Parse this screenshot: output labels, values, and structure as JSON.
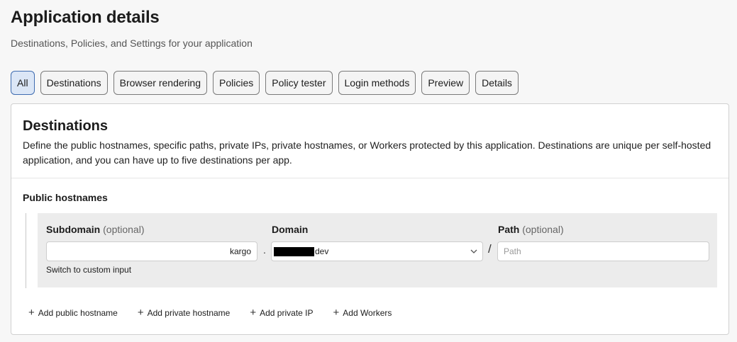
{
  "page": {
    "title": "Application details",
    "subtitle": "Destinations, Policies, and Settings for your application"
  },
  "tabs": [
    {
      "label": "All",
      "active": true
    },
    {
      "label": "Destinations",
      "active": false
    },
    {
      "label": "Browser rendering",
      "active": false
    },
    {
      "label": "Policies",
      "active": false
    },
    {
      "label": "Policy tester",
      "active": false
    },
    {
      "label": "Login methods",
      "active": false
    },
    {
      "label": "Preview",
      "active": false
    },
    {
      "label": "Details",
      "active": false
    }
  ],
  "destinations": {
    "title": "Destinations",
    "description": "Define the public hostnames, specific paths, private IPs, private hostnames, or Workers protected by this application. Destinations are unique per self-hosted application, and you can have up to five destinations per app.",
    "public_hostnames_label": "Public hostnames",
    "subdomain": {
      "label": "Subdomain",
      "optional_text": "(optional)",
      "value": "kargo"
    },
    "domain": {
      "label": "Domain",
      "value_suffix": "dev"
    },
    "path": {
      "label": "Path",
      "optional_text": "(optional)",
      "placeholder": "Path"
    },
    "separator_dot": ".",
    "separator_slash": "/",
    "switch_label": "Switch to custom input",
    "add_actions": [
      {
        "label": "Add public hostname"
      },
      {
        "label": "Add private hostname"
      },
      {
        "label": "Add private IP"
      },
      {
        "label": "Add Workers"
      }
    ]
  },
  "colors": {
    "active_tab_bg": "#dbe6f6",
    "active_tab_border": "#3f6cb0",
    "panel_bg": "#ececec"
  },
  "icons": {
    "domain_select": "chevron-down-icon",
    "add": "plus-icon"
  }
}
